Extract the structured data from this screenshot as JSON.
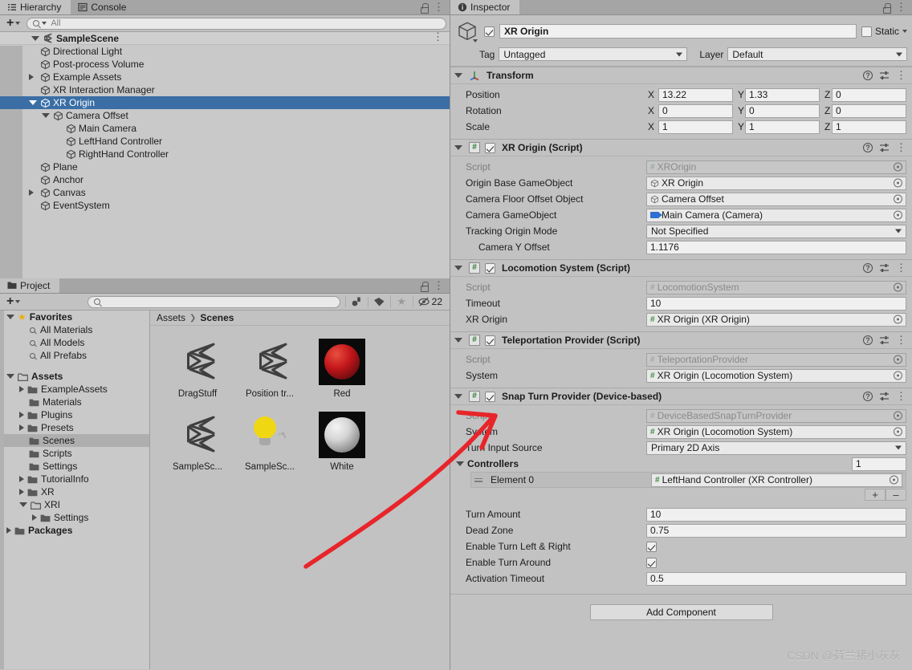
{
  "hierarchy": {
    "tabs": [
      {
        "label": "Hierarchy",
        "icon": "hierarchy-icon",
        "active": true
      },
      {
        "label": "Console",
        "icon": "console-icon",
        "active": false
      }
    ],
    "toolbar": {
      "create_label": "+",
      "search_placeholder": "All",
      "search_value": ""
    },
    "scene": {
      "name": "SampleScene",
      "expanded": true
    },
    "items": [
      {
        "label": "Directional Light",
        "depth": 1,
        "expandable": false,
        "expanded": false,
        "selected": false
      },
      {
        "label": "Post-process Volume",
        "depth": 1,
        "expandable": false,
        "expanded": false,
        "selected": false
      },
      {
        "label": "Example Assets",
        "depth": 1,
        "expandable": true,
        "expanded": false,
        "selected": false
      },
      {
        "label": "XR Interaction Manager",
        "depth": 1,
        "expandable": false,
        "expanded": false,
        "selected": false
      },
      {
        "label": "XR Origin",
        "depth": 1,
        "expandable": true,
        "expanded": true,
        "selected": true
      },
      {
        "label": "Camera Offset",
        "depth": 2,
        "expandable": true,
        "expanded": true,
        "selected": false
      },
      {
        "label": "Main Camera",
        "depth": 3,
        "expandable": false,
        "expanded": false,
        "selected": false
      },
      {
        "label": "LeftHand Controller",
        "depth": 3,
        "expandable": false,
        "expanded": false,
        "selected": false
      },
      {
        "label": "RightHand Controller",
        "depth": 3,
        "expandable": false,
        "expanded": false,
        "selected": false
      },
      {
        "label": "Plane",
        "depth": 1,
        "expandable": false,
        "expanded": false,
        "selected": false
      },
      {
        "label": "Anchor",
        "depth": 1,
        "expandable": false,
        "expanded": false,
        "selected": false
      },
      {
        "label": "Canvas",
        "depth": 1,
        "expandable": true,
        "expanded": false,
        "selected": false
      },
      {
        "label": "EventSystem",
        "depth": 1,
        "expandable": false,
        "expanded": false,
        "selected": false
      }
    ]
  },
  "project": {
    "tabs": [
      {
        "label": "Project",
        "icon": "folder-icon",
        "active": true
      }
    ],
    "toolbar": {
      "create_label": "+",
      "search_placeholder": "",
      "search_value": "",
      "hidden_count": "22"
    },
    "breadcrumb": [
      {
        "label": "Assets",
        "current": false
      },
      {
        "label": "Scenes",
        "current": true
      }
    ],
    "tree": [
      {
        "label": "Favorites",
        "depth": 0,
        "kind": "star",
        "expandable": true,
        "expanded": true,
        "bold": true,
        "selected": false
      },
      {
        "label": "All Materials",
        "depth": 1,
        "kind": "search",
        "expandable": false,
        "expanded": false,
        "bold": false,
        "selected": false
      },
      {
        "label": "All Models",
        "depth": 1,
        "kind": "search",
        "expandable": false,
        "expanded": false,
        "bold": false,
        "selected": false
      },
      {
        "label": "All Prefabs",
        "depth": 1,
        "kind": "search",
        "expandable": false,
        "expanded": false,
        "bold": false,
        "selected": false
      },
      {
        "label": "",
        "depth": 0,
        "kind": "spacer",
        "expandable": false,
        "expanded": false,
        "bold": false,
        "selected": false
      },
      {
        "label": "Assets",
        "depth": 0,
        "kind": "folder-open",
        "expandable": true,
        "expanded": true,
        "bold": true,
        "selected": false
      },
      {
        "label": "ExampleAssets",
        "depth": 1,
        "kind": "folder",
        "expandable": true,
        "expanded": false,
        "bold": false,
        "selected": false
      },
      {
        "label": "Materials",
        "depth": 1,
        "kind": "folder",
        "expandable": false,
        "expanded": false,
        "bold": false,
        "selected": false
      },
      {
        "label": "Plugins",
        "depth": 1,
        "kind": "folder",
        "expandable": true,
        "expanded": false,
        "bold": false,
        "selected": false
      },
      {
        "label": "Presets",
        "depth": 1,
        "kind": "folder",
        "expandable": true,
        "expanded": false,
        "bold": false,
        "selected": false
      },
      {
        "label": "Scenes",
        "depth": 1,
        "kind": "folder",
        "expandable": false,
        "expanded": false,
        "bold": false,
        "selected": true
      },
      {
        "label": "Scripts",
        "depth": 1,
        "kind": "folder",
        "expandable": false,
        "expanded": false,
        "bold": false,
        "selected": false
      },
      {
        "label": "Settings",
        "depth": 1,
        "kind": "folder",
        "expandable": false,
        "expanded": false,
        "bold": false,
        "selected": false
      },
      {
        "label": "TutorialInfo",
        "depth": 1,
        "kind": "folder",
        "expandable": true,
        "expanded": false,
        "bold": false,
        "selected": false
      },
      {
        "label": "XR",
        "depth": 1,
        "kind": "folder",
        "expandable": true,
        "expanded": false,
        "bold": false,
        "selected": false
      },
      {
        "label": "XRI",
        "depth": 1,
        "kind": "folder-open",
        "expandable": true,
        "expanded": true,
        "bold": false,
        "selected": false
      },
      {
        "label": "Settings",
        "depth": 2,
        "kind": "folder",
        "expandable": true,
        "expanded": false,
        "bold": false,
        "selected": false
      },
      {
        "label": "Packages",
        "depth": 0,
        "kind": "folder",
        "expandable": true,
        "expanded": false,
        "bold": true,
        "selected": false
      }
    ],
    "assets": [
      {
        "label": "DragStuff",
        "thumb": "unity-scene-icon"
      },
      {
        "label": "Position tr...",
        "thumb": "unity-scene-icon"
      },
      {
        "label": "Red",
        "thumb": "material-sphere-red"
      },
      {
        "label": "SampleSc...",
        "thumb": "unity-scene-icon"
      },
      {
        "label": "SampleSc...",
        "thumb": "lighting-settings-icon"
      },
      {
        "label": "White",
        "thumb": "material-sphere-white"
      }
    ]
  },
  "inspector": {
    "tabs": [
      {
        "label": "Inspector",
        "icon": "info-icon",
        "active": true
      }
    ],
    "gameobject": {
      "enabled": true,
      "name": "XR Origin",
      "static_label": "Static",
      "static_checked": false,
      "tag_label": "Tag",
      "tag_value": "Untagged",
      "layer_label": "Layer",
      "layer_value": "Default"
    },
    "components": [
      {
        "title": "Transform",
        "icon": "transform-icon",
        "expanded": true,
        "has_enable_checkbox": false,
        "enabled": true,
        "vectors": [
          {
            "label": "Position",
            "x": "13.22",
            "y": "1.33",
            "z": "0"
          },
          {
            "label": "Rotation",
            "x": "0",
            "y": "0",
            "z": "0"
          },
          {
            "label": "Scale",
            "x": "1",
            "y": "1",
            "z": "1"
          }
        ],
        "fields": []
      },
      {
        "title": "XR Origin (Script)",
        "icon": "script-icon",
        "expanded": true,
        "has_enable_checkbox": true,
        "enabled": true,
        "vectors": [],
        "fields": [
          {
            "label": "Script",
            "value": "XROrigin",
            "type": "object",
            "dim": true,
            "icon": "script-mini-icon"
          },
          {
            "label": "Origin Base GameObject",
            "value": "XR Origin",
            "type": "object",
            "dim": false,
            "icon": "cube-mini-icon"
          },
          {
            "label": "Camera Floor Offset Object",
            "value": "Camera Offset",
            "type": "object",
            "dim": false,
            "icon": "cube-mini-icon"
          },
          {
            "label": "Camera GameObject",
            "value": "Main Camera (Camera)",
            "type": "object",
            "dim": false,
            "icon": "camera-mini-icon"
          },
          {
            "label": "Tracking Origin Mode",
            "value": "Not Specified",
            "type": "dropdown",
            "dim": false,
            "icon": ""
          },
          {
            "label": "Camera Y Offset",
            "value": "1.1176",
            "type": "text",
            "dim": false,
            "icon": "",
            "indent": true
          }
        ]
      },
      {
        "title": "Locomotion System (Script)",
        "icon": "script-icon",
        "expanded": true,
        "has_enable_checkbox": true,
        "enabled": true,
        "vectors": [],
        "fields": [
          {
            "label": "Script",
            "value": "LocomotionSystem",
            "type": "object",
            "dim": true,
            "icon": "script-mini-icon"
          },
          {
            "label": "Timeout",
            "value": "10",
            "type": "text",
            "dim": false,
            "icon": ""
          },
          {
            "label": "XR Origin",
            "value": "XR Origin (XR Origin)",
            "type": "object",
            "dim": false,
            "icon": "script-mini-icon"
          }
        ]
      },
      {
        "title": "Teleportation Provider (Script)",
        "icon": "script-icon",
        "expanded": true,
        "has_enable_checkbox": true,
        "enabled": true,
        "vectors": [],
        "fields": [
          {
            "label": "Script",
            "value": "TeleportationProvider",
            "type": "object",
            "dim": true,
            "icon": "script-mini-icon"
          },
          {
            "label": "System",
            "value": "XR Origin (Locomotion System)",
            "type": "object",
            "dim": false,
            "icon": "script-mini-icon"
          }
        ]
      }
    ],
    "snap_turn": {
      "title": "Snap Turn Provider (Device-based)",
      "expanded": true,
      "enabled": true,
      "fields_top": [
        {
          "label": "Script",
          "value": "DeviceBasedSnapTurnProvider",
          "type": "object",
          "dim": true,
          "icon": "script-mini-icon"
        },
        {
          "label": "System",
          "value": "XR Origin (Locomotion System)",
          "type": "object",
          "dim": false,
          "icon": "script-mini-icon"
        },
        {
          "label": "Turn Input Source",
          "value": "Primary 2D Axis",
          "type": "dropdown",
          "dim": false,
          "icon": ""
        }
      ],
      "array": {
        "title": "Controllers",
        "size": "1",
        "elements": [
          {
            "label": "Element 0",
            "value": "LeftHand Controller (XR Controller)",
            "icon": "script-mini-icon"
          }
        ],
        "add_label": "+",
        "remove_label": "–"
      },
      "fields_bottom": [
        {
          "label": "Turn Amount",
          "value": "10",
          "type": "text",
          "checked": false
        },
        {
          "label": "Dead Zone",
          "value": "0.75",
          "type": "text",
          "checked": false
        },
        {
          "label": "Enable Turn Left & Right",
          "value": "",
          "type": "checkbox",
          "checked": true
        },
        {
          "label": "Enable Turn Around",
          "value": "",
          "type": "checkbox",
          "checked": true
        },
        {
          "label": "Activation Timeout",
          "value": "0.5",
          "type": "text",
          "checked": false
        }
      ]
    },
    "add_component_label": "Add Component"
  },
  "annotation": {
    "color": "#e8252a",
    "description": "red-arrow-pointing-to-snap-turn-provider"
  },
  "watermark": {
    "text": "CSDN @荷兰猪小灰灰",
    "color": "#aeaeae"
  }
}
